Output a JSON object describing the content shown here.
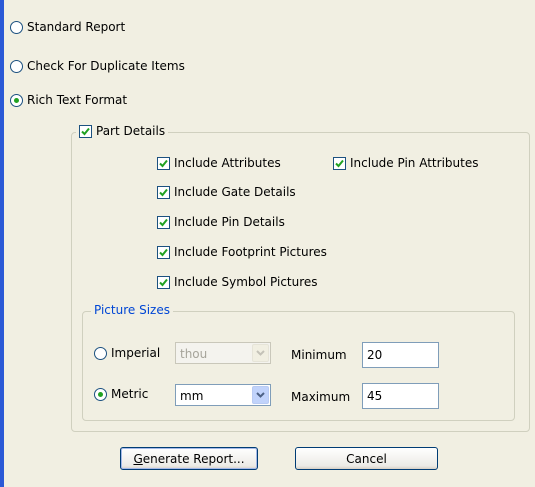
{
  "report_type": {
    "standard": "Standard Report",
    "duplicates": "Check For Duplicate Items",
    "rtf": "Rich Text Format",
    "selected": "rtf"
  },
  "part_details": {
    "label": "Part Details",
    "checked": true,
    "options": {
      "attributes": "Include Attributes",
      "pin_attributes": "Include Pin Attributes",
      "gate_details": "Include Gate Details",
      "pin_details": "Include Pin Details",
      "footprint_pictures": "Include Footprint Pictures",
      "symbol_pictures": "Include Symbol Pictures"
    }
  },
  "picture_sizes": {
    "label": "Picture Sizes",
    "imperial_label": "Imperial",
    "imperial_unit": "thou",
    "metric_label": "Metric",
    "metric_unit": "mm",
    "selected": "metric",
    "minimum_label": "Minimum",
    "minimum_value": "20",
    "maximum_label": "Maximum",
    "maximum_value": "45"
  },
  "buttons": {
    "generate_mnemonic": "G",
    "generate_rest": "enerate Report...",
    "cancel": "Cancel"
  },
  "colors": {
    "accent_bar": "#2b59d6",
    "dialog_bg": "#f1efe2",
    "check_mark": "#21a121",
    "group_title": "#0046d5"
  }
}
